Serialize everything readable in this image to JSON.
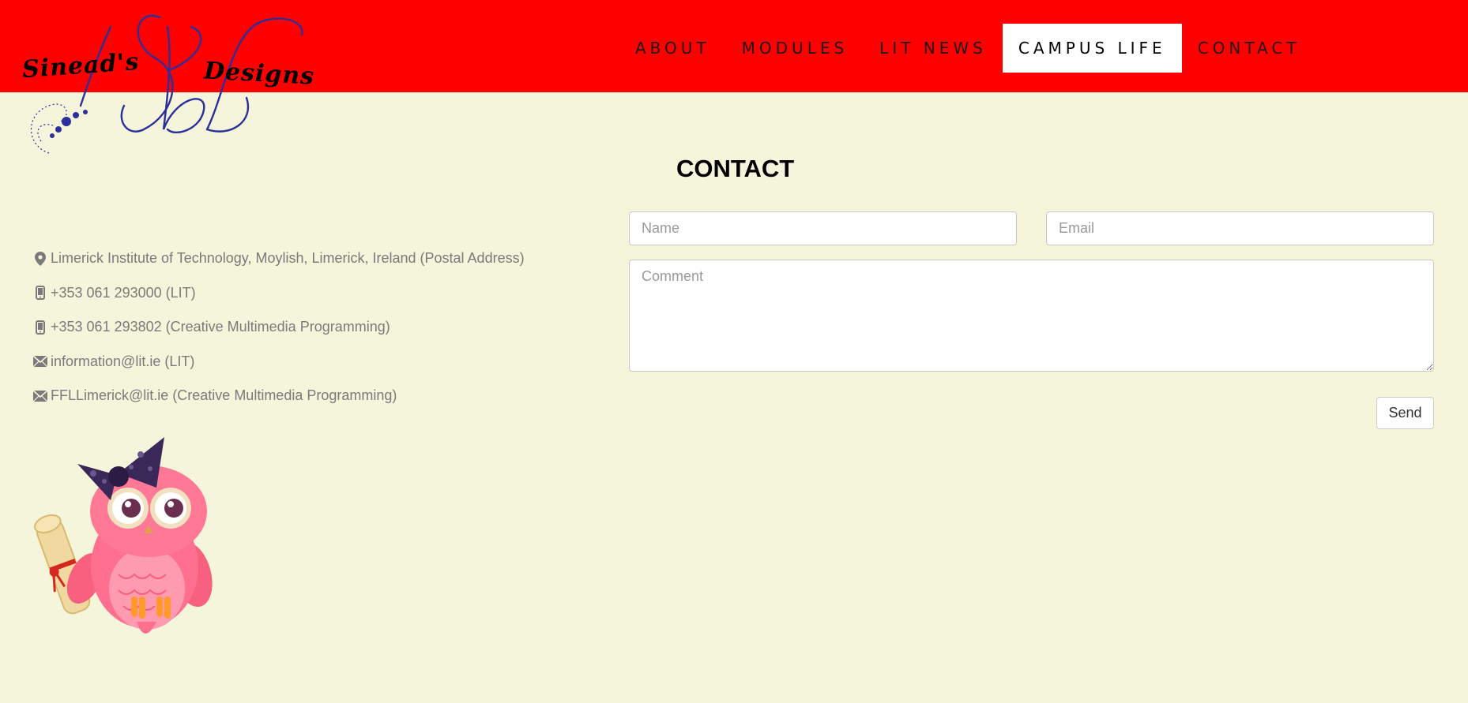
{
  "logo": {
    "left_word": "Sinead's",
    "right_word": "Designs",
    "accent_color": "#2b2f9a"
  },
  "nav": {
    "items": [
      {
        "label": "ABOUT",
        "active": false
      },
      {
        "label": "MODULES",
        "active": false
      },
      {
        "label": "LIT NEWS",
        "active": false
      },
      {
        "label": "CAMPUS LIFE",
        "active": true
      },
      {
        "label": "CONTACT",
        "active": false
      }
    ],
    "background_color": "#ff0000"
  },
  "page": {
    "title": "CONTACT",
    "background_color": "#f5f5dc"
  },
  "contact_info": [
    {
      "icon": "map-marker-icon",
      "text": "Limerick Institute of Technology, Moylish, Limerick, Ireland (Postal Address)"
    },
    {
      "icon": "phone-icon",
      "text": "+353 061 293000 (LIT)"
    },
    {
      "icon": "phone-icon",
      "text": "+353 061 293802 (Creative Multimedia Programming)"
    },
    {
      "icon": "envelope-icon",
      "text": "information@lit.ie (LIT)"
    },
    {
      "icon": "envelope-icon",
      "text": "FFLLimerick@lit.ie (Creative Multimedia Programming)"
    }
  ],
  "form": {
    "name_placeholder": "Name",
    "email_placeholder": "Email",
    "comment_placeholder": "Comment",
    "send_label": "Send"
  }
}
